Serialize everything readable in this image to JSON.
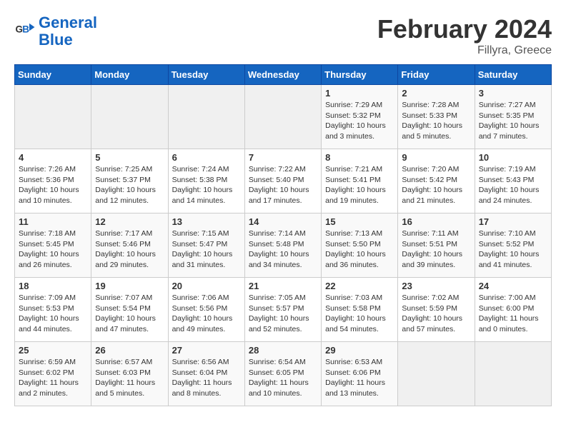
{
  "header": {
    "logo_line1": "General",
    "logo_line2": "Blue",
    "title": "February 2024",
    "subtitle": "Fillyra, Greece"
  },
  "weekdays": [
    "Sunday",
    "Monday",
    "Tuesday",
    "Wednesday",
    "Thursday",
    "Friday",
    "Saturday"
  ],
  "weeks": [
    [
      {
        "day": "",
        "info": ""
      },
      {
        "day": "",
        "info": ""
      },
      {
        "day": "",
        "info": ""
      },
      {
        "day": "",
        "info": ""
      },
      {
        "day": "1",
        "info": "Sunrise: 7:29 AM\nSunset: 5:32 PM\nDaylight: 10 hours\nand 3 minutes."
      },
      {
        "day": "2",
        "info": "Sunrise: 7:28 AM\nSunset: 5:33 PM\nDaylight: 10 hours\nand 5 minutes."
      },
      {
        "day": "3",
        "info": "Sunrise: 7:27 AM\nSunset: 5:35 PM\nDaylight: 10 hours\nand 7 minutes."
      }
    ],
    [
      {
        "day": "4",
        "info": "Sunrise: 7:26 AM\nSunset: 5:36 PM\nDaylight: 10 hours\nand 10 minutes."
      },
      {
        "day": "5",
        "info": "Sunrise: 7:25 AM\nSunset: 5:37 PM\nDaylight: 10 hours\nand 12 minutes."
      },
      {
        "day": "6",
        "info": "Sunrise: 7:24 AM\nSunset: 5:38 PM\nDaylight: 10 hours\nand 14 minutes."
      },
      {
        "day": "7",
        "info": "Sunrise: 7:22 AM\nSunset: 5:40 PM\nDaylight: 10 hours\nand 17 minutes."
      },
      {
        "day": "8",
        "info": "Sunrise: 7:21 AM\nSunset: 5:41 PM\nDaylight: 10 hours\nand 19 minutes."
      },
      {
        "day": "9",
        "info": "Sunrise: 7:20 AM\nSunset: 5:42 PM\nDaylight: 10 hours\nand 21 minutes."
      },
      {
        "day": "10",
        "info": "Sunrise: 7:19 AM\nSunset: 5:43 PM\nDaylight: 10 hours\nand 24 minutes."
      }
    ],
    [
      {
        "day": "11",
        "info": "Sunrise: 7:18 AM\nSunset: 5:45 PM\nDaylight: 10 hours\nand 26 minutes."
      },
      {
        "day": "12",
        "info": "Sunrise: 7:17 AM\nSunset: 5:46 PM\nDaylight: 10 hours\nand 29 minutes."
      },
      {
        "day": "13",
        "info": "Sunrise: 7:15 AM\nSunset: 5:47 PM\nDaylight: 10 hours\nand 31 minutes."
      },
      {
        "day": "14",
        "info": "Sunrise: 7:14 AM\nSunset: 5:48 PM\nDaylight: 10 hours\nand 34 minutes."
      },
      {
        "day": "15",
        "info": "Sunrise: 7:13 AM\nSunset: 5:50 PM\nDaylight: 10 hours\nand 36 minutes."
      },
      {
        "day": "16",
        "info": "Sunrise: 7:11 AM\nSunset: 5:51 PM\nDaylight: 10 hours\nand 39 minutes."
      },
      {
        "day": "17",
        "info": "Sunrise: 7:10 AM\nSunset: 5:52 PM\nDaylight: 10 hours\nand 41 minutes."
      }
    ],
    [
      {
        "day": "18",
        "info": "Sunrise: 7:09 AM\nSunset: 5:53 PM\nDaylight: 10 hours\nand 44 minutes."
      },
      {
        "day": "19",
        "info": "Sunrise: 7:07 AM\nSunset: 5:54 PM\nDaylight: 10 hours\nand 47 minutes."
      },
      {
        "day": "20",
        "info": "Sunrise: 7:06 AM\nSunset: 5:56 PM\nDaylight: 10 hours\nand 49 minutes."
      },
      {
        "day": "21",
        "info": "Sunrise: 7:05 AM\nSunset: 5:57 PM\nDaylight: 10 hours\nand 52 minutes."
      },
      {
        "day": "22",
        "info": "Sunrise: 7:03 AM\nSunset: 5:58 PM\nDaylight: 10 hours\nand 54 minutes."
      },
      {
        "day": "23",
        "info": "Sunrise: 7:02 AM\nSunset: 5:59 PM\nDaylight: 10 hours\nand 57 minutes."
      },
      {
        "day": "24",
        "info": "Sunrise: 7:00 AM\nSunset: 6:00 PM\nDaylight: 11 hours\nand 0 minutes."
      }
    ],
    [
      {
        "day": "25",
        "info": "Sunrise: 6:59 AM\nSunset: 6:02 PM\nDaylight: 11 hours\nand 2 minutes."
      },
      {
        "day": "26",
        "info": "Sunrise: 6:57 AM\nSunset: 6:03 PM\nDaylight: 11 hours\nand 5 minutes."
      },
      {
        "day": "27",
        "info": "Sunrise: 6:56 AM\nSunset: 6:04 PM\nDaylight: 11 hours\nand 8 minutes."
      },
      {
        "day": "28",
        "info": "Sunrise: 6:54 AM\nSunset: 6:05 PM\nDaylight: 11 hours\nand 10 minutes."
      },
      {
        "day": "29",
        "info": "Sunrise: 6:53 AM\nSunset: 6:06 PM\nDaylight: 11 hours\nand 13 minutes."
      },
      {
        "day": "",
        "info": ""
      },
      {
        "day": "",
        "info": ""
      }
    ]
  ]
}
